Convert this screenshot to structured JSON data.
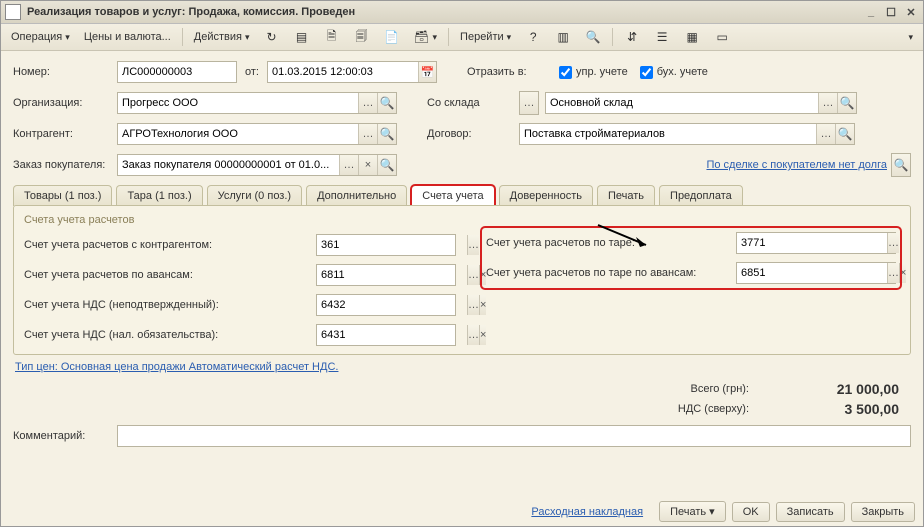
{
  "title": "Реализация товаров и услуг: Продажа, комиссия. Проведен",
  "toolbar": {
    "operation": "Операция",
    "prices": "Цены и валюта...",
    "actions": "Действия",
    "goto": "Перейти"
  },
  "labels": {
    "number": "Номер:",
    "from": "от:",
    "org": "Организация:",
    "contragent": "Контрагент:",
    "order": "Заказ покупателя:",
    "reflect": "Отразить в:",
    "mgmt": "упр. учете",
    "acct": "бух. учете",
    "warehouse": "Со склада",
    "contract": "Договор:",
    "comment": "Комментарий:"
  },
  "values": {
    "number": "ЛС000000003",
    "date": "01.03.2015 12:00:03",
    "org": "Прогресс ООО",
    "contragent": "АГРОТехнология ООО",
    "order": "Заказ покупателя 00000000001 от 01.0...",
    "warehouse": "Основной склад",
    "contract": "Поставка стройматериалов",
    "debt_link": "По сделке с покупателем нет долга"
  },
  "tabs": {
    "goods": "Товары (1 поз.)",
    "tare": "Тара (1 поз.)",
    "services": "Услуги (0 поз.)",
    "extra": "Дополнительно",
    "accounts": "Счета учета",
    "proxy": "Доверенность",
    "print": "Печать",
    "prepay": "Предоплата"
  },
  "panel": {
    "title": "Счета учета расчетов",
    "l_contragent": "Счет учета расчетов с контрагентом:",
    "l_advance": "Счет учета расчетов по авансам:",
    "l_vat_unconf": "Счет учета НДС (неподтвержденный):",
    "l_vat_obl": "Счет учета НДС (нал. обязательства):",
    "l_tare": "Счет учета расчетов по таре:",
    "l_tare_adv": "Счет учета расчетов по таре по авансам:",
    "v_contragent": "361",
    "v_advance": "6811",
    "v_vat_unconf": "6432",
    "v_vat_obl": "6431",
    "v_tare": "3771",
    "v_tare_adv": "6851"
  },
  "tip": "Тип цен: Основная цена продажи Автоматический расчет НДС.",
  "totals": {
    "total_lbl": "Всего (грн):",
    "total_val": "21 000,00",
    "vat_lbl": "НДС (сверху):",
    "vat_val": "3 500,00"
  },
  "footer": {
    "invoice": "Расходная накладная",
    "print": "Печать",
    "ok": "OK",
    "save": "Записать",
    "close": "Закрыть"
  }
}
